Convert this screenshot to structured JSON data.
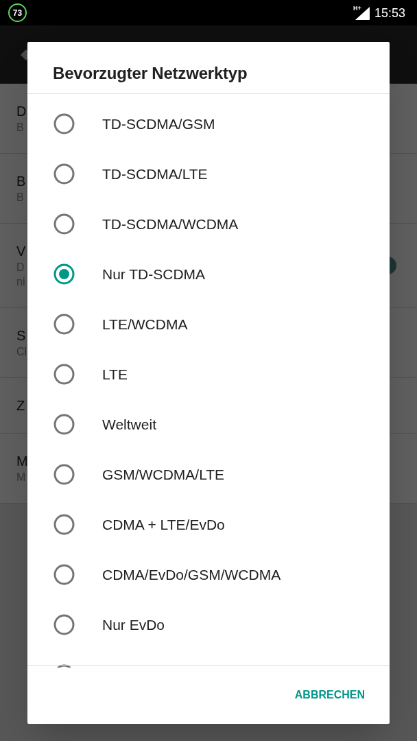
{
  "status_bar": {
    "battery": "73",
    "network": "H+",
    "time": "15:53"
  },
  "settings": [
    {
      "title": "D",
      "summary_lines": [
        "B"
      ]
    },
    {
      "title": "B",
      "summary_lines": [
        "B"
      ]
    },
    {
      "title": "V",
      "summary_lines": [
        "D",
        "ni"
      ],
      "switch": {
        "on": true
      }
    },
    {
      "title": "S",
      "summary_lines": [
        "Cl"
      ]
    },
    {
      "title": "Z"
    },
    {
      "title": "M",
      "summary_lines": [
        "M"
      ]
    }
  ],
  "dialog": {
    "title": "Bevorzugter Netzwerktyp",
    "options": [
      {
        "label": "TD-SCDMA/GSM",
        "selected": false
      },
      {
        "label": "TD-SCDMA/LTE",
        "selected": false
      },
      {
        "label": "TD-SCDMA/WCDMA",
        "selected": false
      },
      {
        "label": "Nur TD-SCDMA",
        "selected": true
      },
      {
        "label": "LTE/WCDMA",
        "selected": false
      },
      {
        "label": "LTE",
        "selected": false
      },
      {
        "label": "Weltweit",
        "selected": false
      },
      {
        "label": "GSM/WCDMA/LTE",
        "selected": false
      },
      {
        "label": "CDMA + LTE/EvDo",
        "selected": false
      },
      {
        "label": "CDMA/EvDo/GSM/WCDMA",
        "selected": false
      },
      {
        "label": "Nur EvDo",
        "selected": false
      },
      {
        "selected": false
      }
    ],
    "buttons": [
      "ABBRECHEN"
    ]
  }
}
